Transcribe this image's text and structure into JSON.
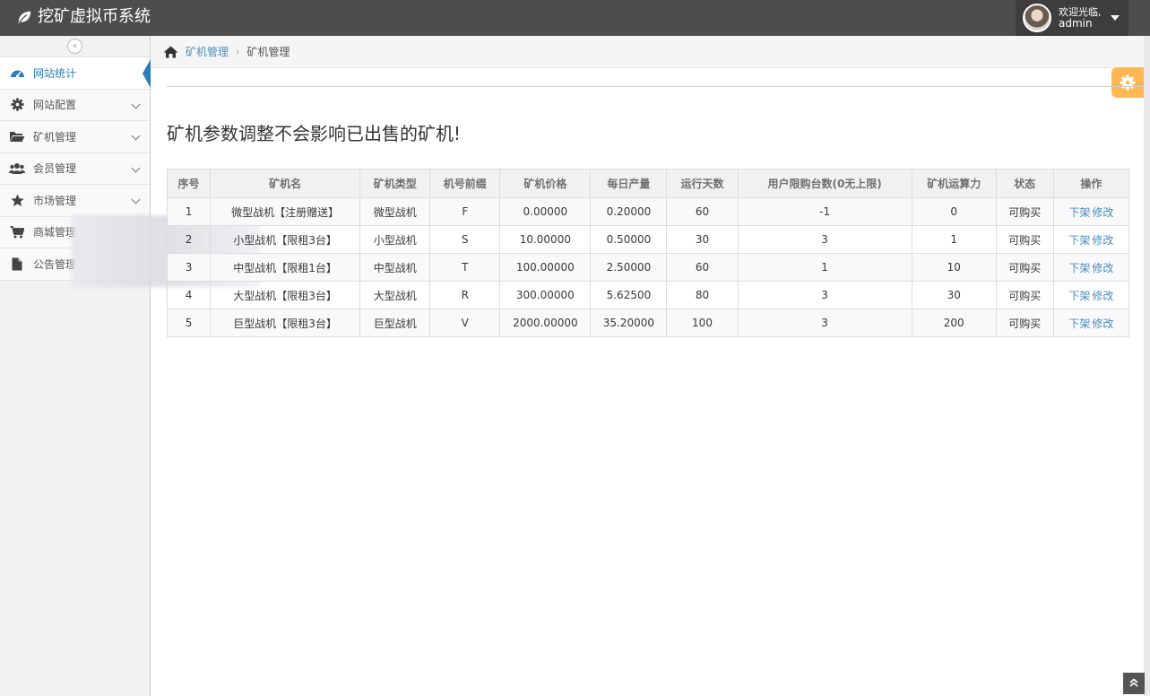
{
  "app": {
    "title": "挖矿虚拟币系统"
  },
  "user": {
    "greeting": "欢迎光临,",
    "name": "admin"
  },
  "sidebar": {
    "collapse_label": "«",
    "items": [
      {
        "label": "网站统计",
        "icon": "dashboard-icon",
        "active": true
      },
      {
        "label": "网站配置",
        "icon": "gear-icon"
      },
      {
        "label": "矿机管理",
        "icon": "folder-open-icon"
      },
      {
        "label": "会员管理",
        "icon": "users-icon"
      },
      {
        "label": "市场管理",
        "icon": "star-icon"
      },
      {
        "label": "商城管理",
        "icon": "cart-icon"
      },
      {
        "label": "公告管理",
        "icon": "document-icon"
      }
    ]
  },
  "breadcrumb": {
    "link": "矿机管理",
    "current": "矿机管理"
  },
  "notice": "矿机参数调整不会影响已出售的矿机!",
  "table": {
    "headers": [
      "序号",
      "矿机名",
      "矿机类型",
      "机号前缀",
      "矿机价格",
      "每日产量",
      "运行天数",
      "用户限购台数(0无上限)",
      "矿机运算力",
      "状态",
      "操作"
    ],
    "rows": [
      [
        "1",
        "微型战机【注册赠送】",
        "微型战机",
        "F",
        "0.00000",
        "0.20000",
        "60",
        "-1",
        "0",
        "可购买"
      ],
      [
        "2",
        "小型战机【限租3台】",
        "小型战机",
        "S",
        "10.00000",
        "0.50000",
        "30",
        "3",
        "1",
        "可购买"
      ],
      [
        "3",
        "中型战机【限租1台】",
        "中型战机",
        "T",
        "100.00000",
        "2.50000",
        "60",
        "1",
        "10",
        "可购买"
      ],
      [
        "4",
        "大型战机【限租3台】",
        "大型战机",
        "R",
        "300.00000",
        "5.62500",
        "80",
        "3",
        "30",
        "可购买"
      ],
      [
        "5",
        "巨型战机【限租3台】",
        "巨型战机",
        "V",
        "2000.00000",
        "35.20000",
        "100",
        "3",
        "200",
        "可购买"
      ]
    ],
    "actions": {
      "off_shelf": "下架",
      "edit": "修改"
    }
  },
  "colors": {
    "navbar": "#4d4d4d",
    "accent": "#2b7dbc",
    "status_green": "#3c8d2f",
    "gear_tab": "#ffb752"
  }
}
